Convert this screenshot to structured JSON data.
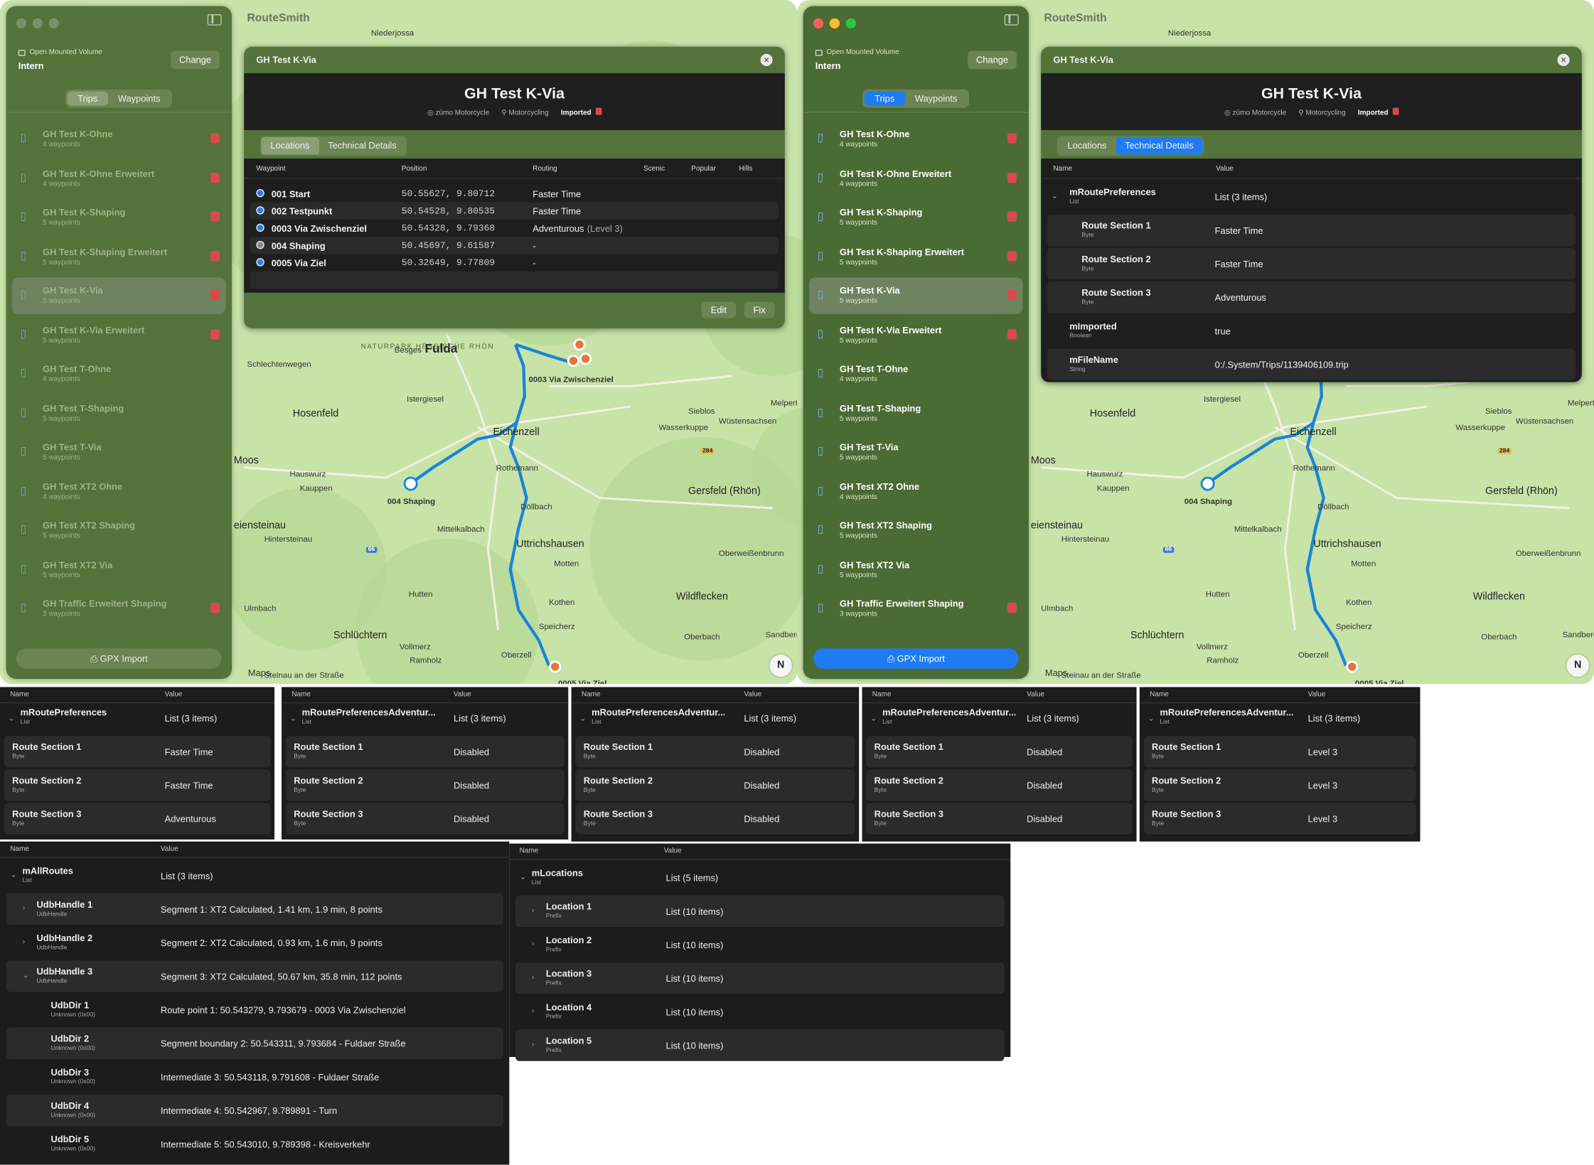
{
  "app_title": "RouteSmith",
  "sidebar": {
    "volume_label": "Open Mounted Volume",
    "volume_name": "Intern",
    "change_label": "Change",
    "tabs": [
      "Trips",
      "Waypoints"
    ],
    "gpx_import_label": "GPX Import",
    "trips": [
      {
        "name": "GH Test K-Ohne",
        "count": "4 waypoints",
        "badge": true
      },
      {
        "name": "GH Test K-Ohne Erweitert",
        "count": "4 waypoints",
        "badge": true
      },
      {
        "name": "GH Test K-Shaping",
        "count": "5 waypoints",
        "badge": true
      },
      {
        "name": "GH Test K-Shaping Erweitert",
        "count": "5 waypoints",
        "badge": true
      },
      {
        "name": "GH Test K-Via",
        "count": "5 waypoints",
        "badge": true
      },
      {
        "name": "GH Test K-Via Erweitert",
        "count": "5 waypoints",
        "badge": true
      },
      {
        "name": "GH Test T-Ohne",
        "count": "4 waypoints",
        "badge": false
      },
      {
        "name": "GH Test T-Shaping",
        "count": "5 waypoints",
        "badge": false
      },
      {
        "name": "GH Test T-Via",
        "count": "5 waypoints",
        "badge": false
      },
      {
        "name": "GH Test XT2 Ohne",
        "count": "4 waypoints",
        "badge": false
      },
      {
        "name": "GH Test XT2 Shaping",
        "count": "5 waypoints",
        "badge": false
      },
      {
        "name": "GH Test XT2 Via",
        "count": "5 waypoints",
        "badge": false
      },
      {
        "name": "GH Traffic Erweitert Shaping",
        "count": "3 waypoints",
        "badge": true
      }
    ],
    "selected_index": 4
  },
  "detail": {
    "window_title": "GH Test K-Via",
    "title": "GH Test K-Via",
    "device": "zūmo Motorcycle",
    "profile": "Motorcycling",
    "status": "Imported",
    "tabs": [
      "Locations",
      "Technical Details"
    ],
    "edit_label": "Edit",
    "fix_label": "Fix",
    "loc_columns": [
      "Waypoint",
      "Position",
      "Routing",
      "Scenic",
      "Popular",
      "Hills"
    ],
    "locations": [
      {
        "name": "001 Start",
        "position": "50.55627, 9.80712",
        "routing": "Faster Time",
        "level": "",
        "kind": "via"
      },
      {
        "name": "002 Testpunkt",
        "position": "50.54528, 9.80535",
        "routing": "Faster Time",
        "level": "",
        "kind": "via"
      },
      {
        "name": "0003 Via Zwischenziel",
        "position": "50.54328, 9.79368",
        "routing": "Adventurous",
        "level": "(Level 3)",
        "kind": "via"
      },
      {
        "name": "004 Shaping",
        "position": "50.45697, 9.61587",
        "routing": "-",
        "level": "",
        "kind": "shaping"
      },
      {
        "name": "0005 Via Ziel",
        "position": "50.32649, 9.77809",
        "routing": "-",
        "level": "",
        "kind": "via"
      }
    ],
    "tech_columns": [
      "Name",
      "Value"
    ],
    "tech_rows": [
      {
        "name": "mRoutePreferences",
        "type": "List",
        "value": "List (3 items)",
        "indent": 0,
        "expanded": true
      },
      {
        "name": "Route Section 1",
        "type": "Byte",
        "value": "Faster Time",
        "indent": 1
      },
      {
        "name": "Route Section 2",
        "type": "Byte",
        "value": "Faster Time",
        "indent": 1
      },
      {
        "name": "Route Section 3",
        "type": "Byte",
        "value": "Adventurous",
        "indent": 1
      },
      {
        "name": "mImported",
        "type": "Boolean",
        "value": "true",
        "indent": 0
      },
      {
        "name": "mFileName",
        "type": "String",
        "value": "0:/.System/Trips/1139406109.trip",
        "indent": 0
      }
    ]
  },
  "map": {
    "labels": [
      "Niederjossa",
      "Fulda",
      "Besges",
      "Schlechtenwegen",
      "Hosenfeld",
      "Istergiesel",
      "Eichenzell",
      "Rothemann",
      "Hauswurz",
      "Kauppen",
      "Moos",
      "Döllbach",
      "Mittelkalbach",
      "Uttrichshausen",
      "Hintersteinau",
      "Motten",
      "Hutten",
      "Kothen",
      "Wildflecken",
      "Ulmbach",
      "Schlüchtern",
      "Speicherz",
      "Vollmerz",
      "Ramholz",
      "Oberzell",
      "Gersfeld (Rhön)",
      "Wasserkuppe",
      "Sieblos",
      "Wüstensachsen",
      "Melperts",
      "Oberweißenbrunn",
      "Oberbach",
      "Sandberg",
      "Steinau an der Straße",
      "eiensteinau"
    ],
    "park": "NATURPARK HESSISCHE RHÖN",
    "route_labels": [
      "0003 Via Zwischenziel",
      "004 Shaping",
      "0005 Via Ziel"
    ],
    "compass": "N",
    "attribution": "Maps",
    "road_numbers": [
      "284",
      "66"
    ]
  },
  "prefs_panels": [
    {
      "title": "mRoutePreferences",
      "type": "List",
      "value": "List (3 items)",
      "items": [
        "Faster Time",
        "Faster Time",
        "Adventurous"
      ]
    },
    {
      "title": "mRoutePreferencesAdventur...",
      "type": "List",
      "value": "List (3 items)",
      "items": [
        "Disabled",
        "Disabled",
        "Disabled"
      ]
    },
    {
      "title": "mRoutePreferencesAdventur...",
      "type": "List",
      "value": "List (3 items)",
      "items": [
        "Disabled",
        "Disabled",
        "Disabled"
      ]
    },
    {
      "title": "mRoutePreferencesAdventur...",
      "type": "List",
      "value": "List (3 items)",
      "items": [
        "Disabled",
        "Disabled",
        "Disabled"
      ]
    },
    {
      "title": "mRoutePreferencesAdventur...",
      "type": "List",
      "value": "List (3 items)",
      "items": [
        "Level 3",
        "Level 3",
        "Level 3"
      ]
    }
  ],
  "pref_item_names": [
    "Route Section 1",
    "Route Section 2",
    "Route Section 3"
  ],
  "pref_item_type": "Byte",
  "routes_panel": {
    "columns": [
      "Name",
      "Value"
    ],
    "rows": [
      {
        "name": "mAllRoutes",
        "type": "List",
        "value": "List (3 items)",
        "indent": 0,
        "chev": "down"
      },
      {
        "name": "UdbHandle 1",
        "type": "UdbHandle",
        "value": "Segment 1: XT2 Calculated, 1.41 km, 1.9 min, 8 points",
        "indent": 1,
        "chev": "right"
      },
      {
        "name": "UdbHandle 2",
        "type": "UdbHandle",
        "value": "Segment 2: XT2 Calculated, 0.93 km, 1.6 min, 9 points",
        "indent": 1,
        "chev": "right"
      },
      {
        "name": "UdbHandle 3",
        "type": "UdbHandle",
        "value": "Segment 3: XT2 Calculated, 50.67 km, 35.8 min, 112 points",
        "indent": 1,
        "chev": "down"
      },
      {
        "name": "UdbDir 1",
        "type": "Unknown (0x00)",
        "value": "Route point 1: 50.543279, 9.793679 - 0003 Via Zwischenziel",
        "indent": 2,
        "chev": ""
      },
      {
        "name": "UdbDir 2",
        "type": "Unknown (0x00)",
        "value": "Segment boundary 2: 50.543311, 9.793684 - Fuldaer Straße",
        "indent": 2,
        "chev": ""
      },
      {
        "name": "UdbDir 3",
        "type": "Unknown (0x00)",
        "value": "Intermediate 3: 50.543118, 9.791608 - Fuldaer Straße",
        "indent": 2,
        "chev": ""
      },
      {
        "name": "UdbDir 4",
        "type": "Unknown (0x00)",
        "value": "Intermediate 4: 50.542967, 9.789891 - Turn",
        "indent": 2,
        "chev": ""
      },
      {
        "name": "UdbDir 5",
        "type": "Unknown (0x00)",
        "value": "Intermediate 5: 50.543010, 9.789398 - Kreisverkehr",
        "indent": 2,
        "chev": ""
      }
    ]
  },
  "locations_panel": {
    "columns": [
      "Name",
      "Value"
    ],
    "rows": [
      {
        "name": "mLocations",
        "type": "List",
        "value": "List (5 items)",
        "indent": 0,
        "chev": "down"
      },
      {
        "name": "Location 1",
        "type": "Prefix",
        "value": "List (10 items)",
        "indent": 1,
        "chev": "right"
      },
      {
        "name": "Location 2",
        "type": "Prefix",
        "value": "List (10 items)",
        "indent": 1,
        "chev": "right"
      },
      {
        "name": "Location 3",
        "type": "Prefix",
        "value": "List (10 items)",
        "indent": 1,
        "chev": "right"
      },
      {
        "name": "Location 4",
        "type": "Prefix",
        "value": "List (10 items)",
        "indent": 1,
        "chev": "right"
      },
      {
        "name": "Location 5",
        "type": "Prefix",
        "value": "List (10 items)",
        "indent": 1,
        "chev": "right"
      }
    ]
  },
  "colors": {
    "accent_blue": "#1e7bf2",
    "window_green": "#53733b",
    "badge_red": "#d84b4b"
  }
}
